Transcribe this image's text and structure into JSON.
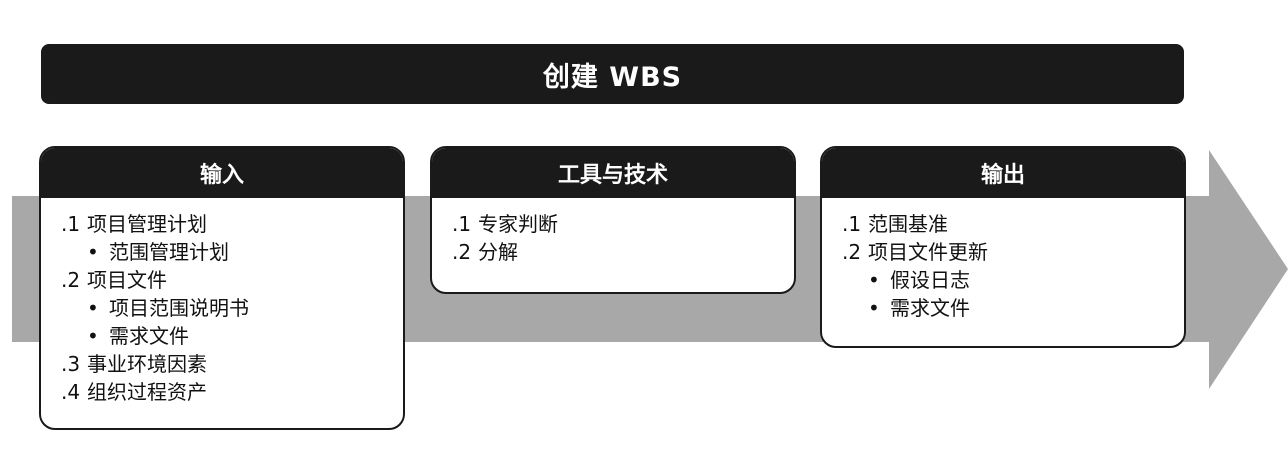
{
  "title": "创建 WBS",
  "inputs": {
    "header": "输入",
    "items": [
      {
        "num": ".1",
        "label": "项目管理计划"
      },
      {
        "bullet": "•",
        "label": "范围管理计划"
      },
      {
        "num": ".2",
        "label": "项目文件"
      },
      {
        "bullet": "•",
        "label": "项目范围说明书"
      },
      {
        "bullet": "•",
        "label": "需求文件"
      },
      {
        "num": ".3",
        "label": "事业环境因素"
      },
      {
        "num": ".4",
        "label": "组织过程资产"
      }
    ]
  },
  "tools": {
    "header": "工具与技术",
    "items": [
      {
        "num": ".1",
        "label": "专家判断"
      },
      {
        "num": ".2",
        "label": "分解"
      }
    ]
  },
  "outputs": {
    "header": "输出",
    "items": [
      {
        "num": ".1",
        "label": "范围基准"
      },
      {
        "num": ".2",
        "label": "项目文件更新"
      },
      {
        "bullet": "•",
        "label": "假设日志"
      },
      {
        "bullet": "•",
        "label": "需求文件"
      }
    ]
  },
  "colors": {
    "dark": "#1a1a1a",
    "arrow": "#a8a8a8",
    "background": "#ffffff"
  }
}
